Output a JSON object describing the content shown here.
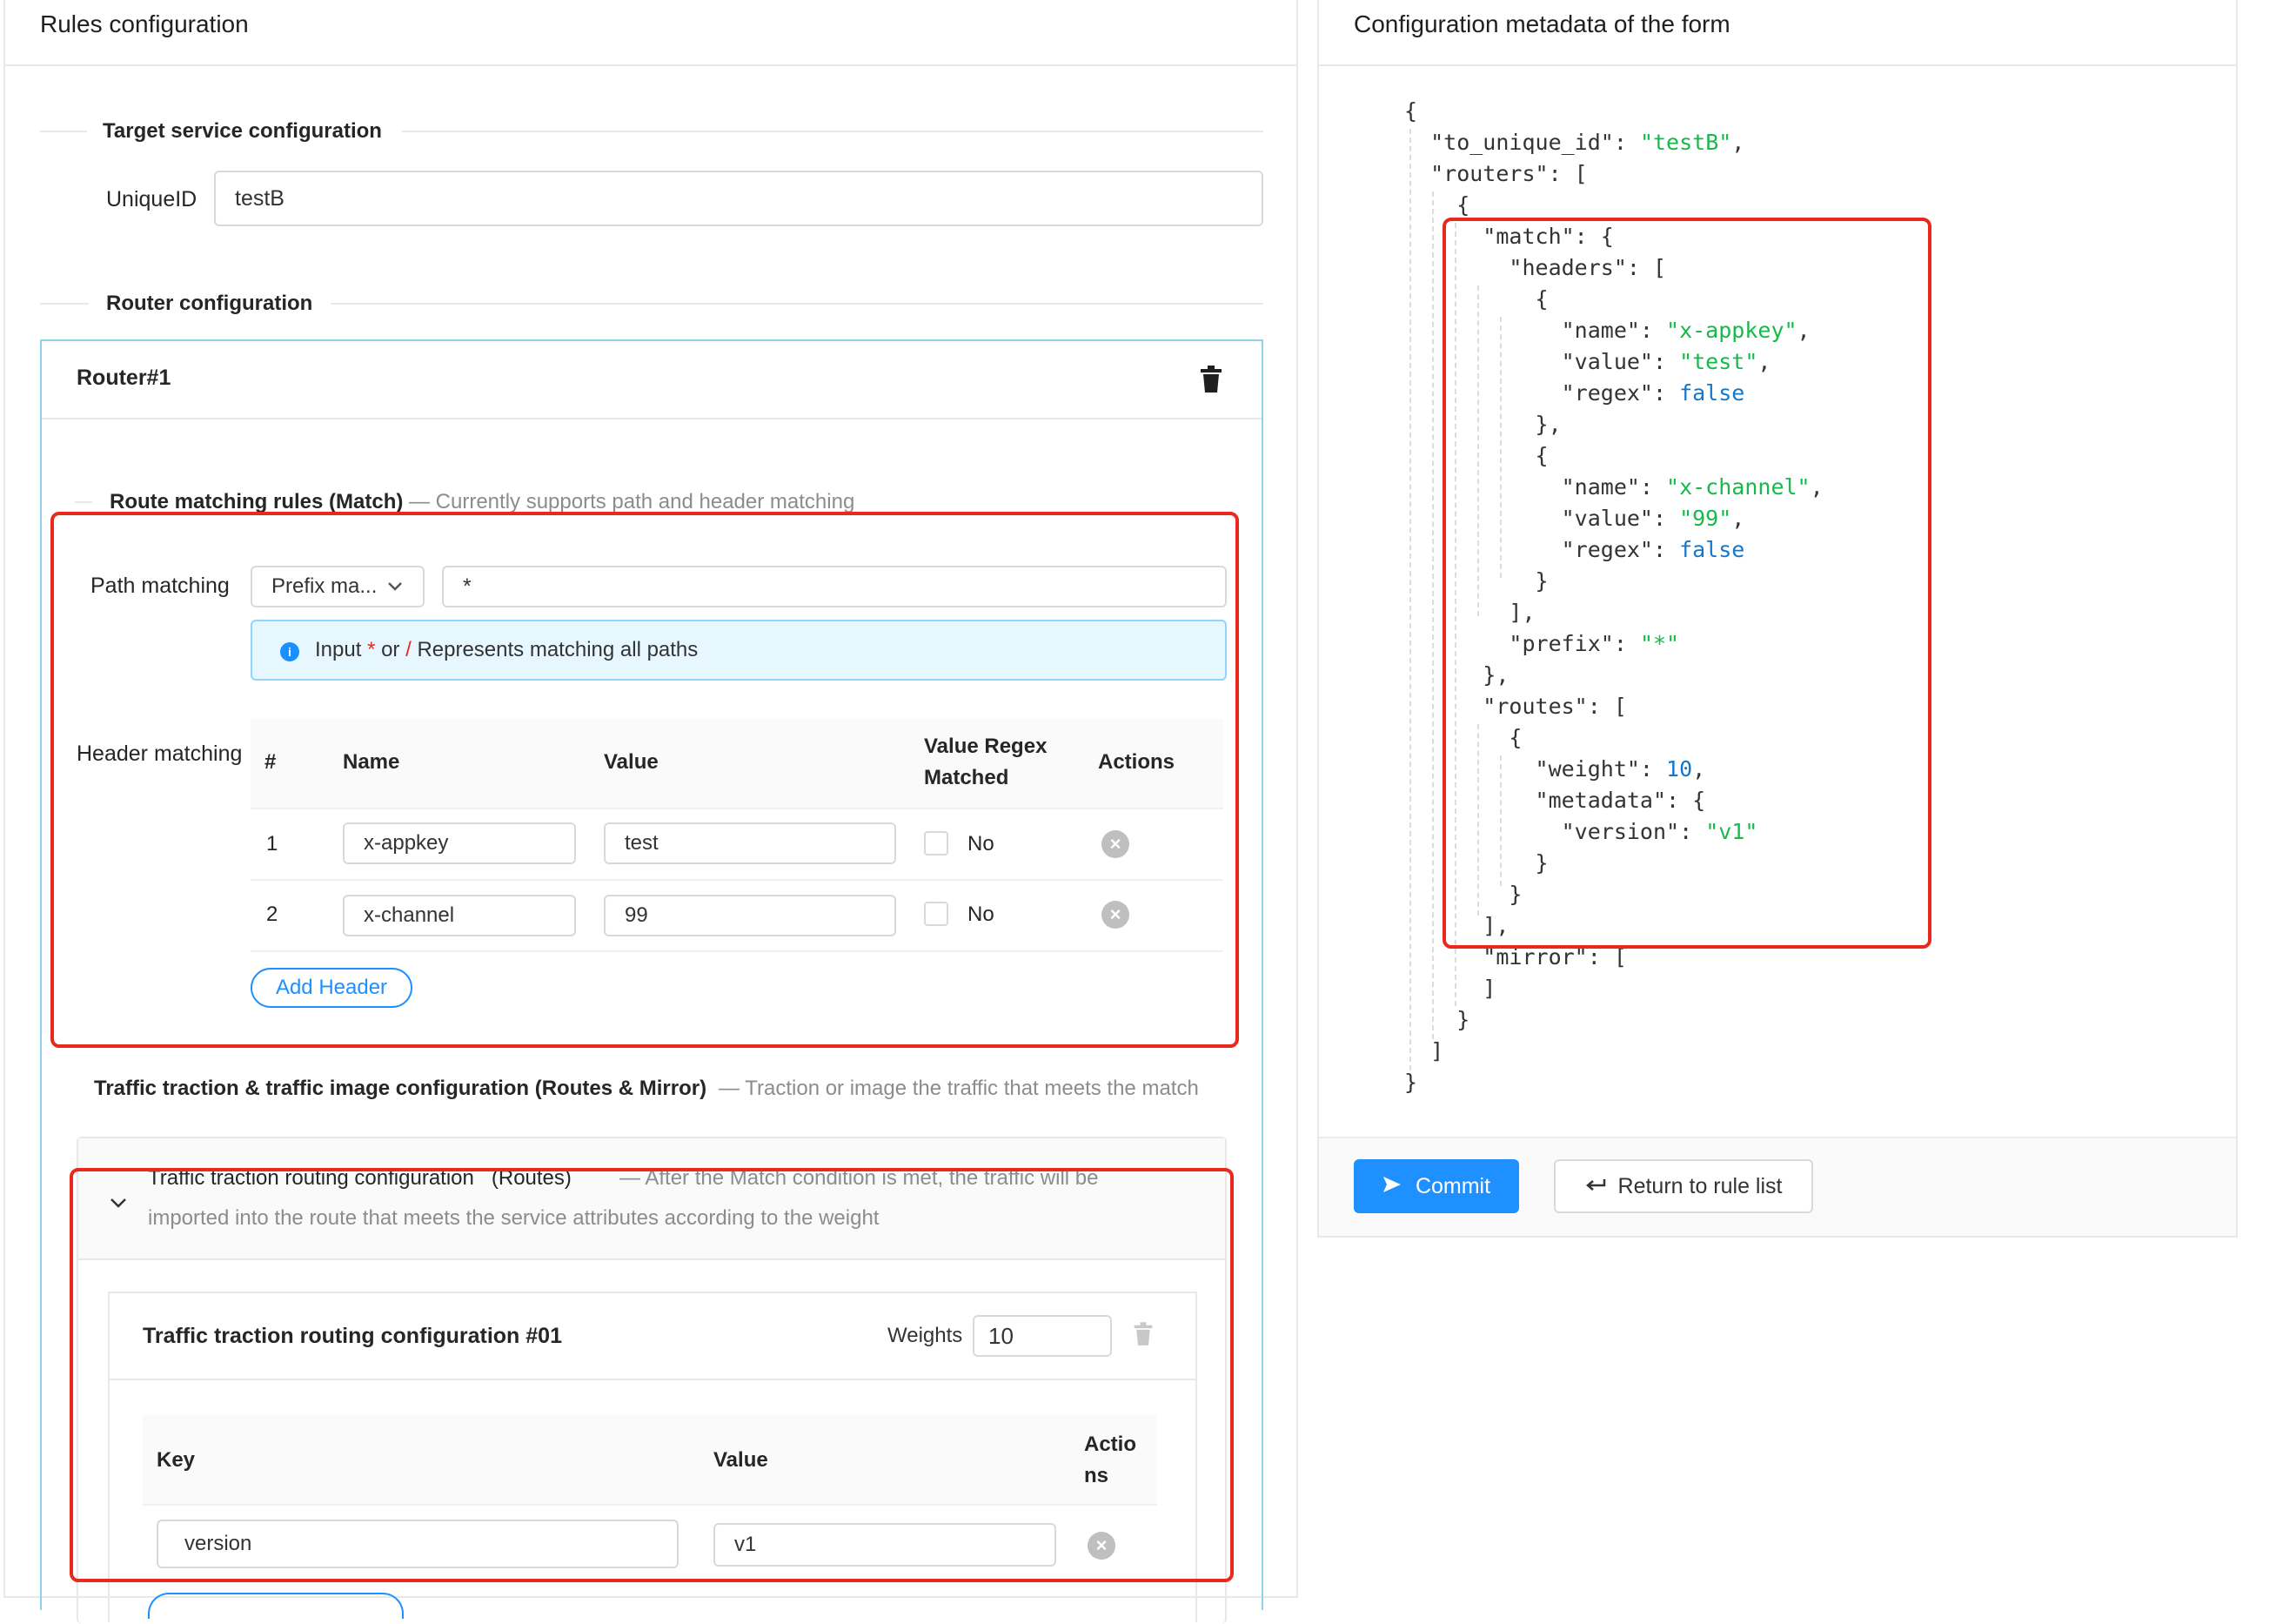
{
  "left_title": "Rules configuration",
  "target_section": "Target service configuration",
  "uniqueid_label": "UniqueID",
  "uniqueid_value": "testB",
  "router_section": "Router configuration",
  "router_title": "Router#1",
  "match_title": "Route matching rules (Match)",
  "match_desc": "— Currently supports path and header matching",
  "path_label": "Path matching",
  "path_select": "Prefix ma...",
  "path_value": "*",
  "info": {
    "p1": "Input",
    "star": "*",
    "p2": "or",
    "slash": "/",
    "p3": "Represents matching all paths"
  },
  "header_label": "Header matching",
  "header_table": {
    "cols": [
      "#",
      "Name",
      "Value",
      "Value Regex\nMatched",
      "Actions"
    ],
    "rows": [
      {
        "idx": "1",
        "name": "x-appkey",
        "value": "test",
        "regex": "No"
      },
      {
        "idx": "2",
        "name": "x-channel",
        "value": "99",
        "regex": "No"
      }
    ]
  },
  "add_header": "Add Header",
  "traffic_title": "Traffic traction & traffic image configuration (Routes & Mirror)",
  "traffic_desc": "— Traction or image the traffic that meets the match",
  "routes_title": "Traffic traction routing configuration   (Routes)",
  "routes_desc_1": "— After the Match condition is met, the traffic will be",
  "routes_desc_2": "imported into the route that meets the service attributes according to the weight",
  "route_card_title": "Traffic traction routing configuration #01",
  "weights_label": "Weights",
  "weights_value": "10",
  "kv_table": {
    "cols": [
      "Key",
      "Value",
      "Actio\nns"
    ],
    "rows": [
      {
        "key": "version",
        "value": "v1"
      }
    ]
  },
  "right_title": "Configuration metadata of the form",
  "json_lines": [
    "{",
    "  \"to_unique_id\": \"testB\",",
    "  \"routers\": [",
    "    {",
    "      \"match\": {",
    "        \"headers\": [",
    "          {",
    "            \"name\": \"x-appkey\",",
    "            \"value\": \"test\",",
    "            \"regex\": false",
    "          },",
    "          {",
    "            \"name\": \"x-channel\",",
    "            \"value\": \"99\",",
    "            \"regex\": false",
    "          }",
    "        ],",
    "        \"prefix\": \"*\"",
    "      },",
    "      \"routes\": [",
    "        {",
    "          \"weight\": 10,",
    "          \"metadata\": {",
    "            \"version\": \"v1\"",
    "          }",
    "        }",
    "      ],",
    "      \"mirror\": [",
    "      ]",
    "    }",
    "  ]",
    "}"
  ],
  "commit": "Commit",
  "return": "Return to rule list",
  "colors": {
    "accent": "#1e90ff",
    "highlight": "#e8291c",
    "json_string": "#17b94a",
    "json_literal": "#1677c8"
  }
}
